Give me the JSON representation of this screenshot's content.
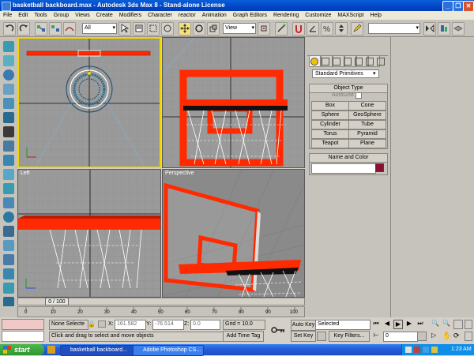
{
  "window": {
    "title": "basketball backboard.max - Autodesk 3ds Max 8  - Stand-alone License",
    "controls": [
      "minimize-icon",
      "restore-icon",
      "close-icon"
    ]
  },
  "menu": [
    "File",
    "Edit",
    "Tools",
    "Group",
    "Views",
    "Create",
    "Modifiers",
    "Character",
    "reactor",
    "Animation",
    "Graph Editors",
    "Rendering",
    "Customize",
    "MAXScript",
    "Help"
  ],
  "toolbar": {
    "selection_filter": "All",
    "ref_coord": "View",
    "named_sets": ""
  },
  "viewports": {
    "top_left": "",
    "top_right": "",
    "bottom_left": "Left",
    "bottom_right": "Perspective"
  },
  "command_panel": {
    "category": "Standard Primitives",
    "object_type_title": "Object Type",
    "autogrid": "AutoGrid",
    "buttons": [
      "Box",
      "Cone",
      "Sphere",
      "GeoSphere",
      "Cylinder",
      "Tube",
      "Torus",
      "Pyramid",
      "Teapot",
      "Plane"
    ],
    "name_color_title": "Name and Color",
    "object_name": "",
    "color_hex": "#8b1030"
  },
  "timeline": {
    "frame": "0 / 100",
    "ticks": [
      "0",
      "10",
      "20",
      "30",
      "40",
      "50",
      "60",
      "70",
      "80",
      "90",
      "100"
    ]
  },
  "status": {
    "selection": "None Selecte",
    "x_label": "X:",
    "x_value": "161.582",
    "y_label": "Y:",
    "y_value": "-76.514",
    "z_label": "Z:",
    "z_value": "0.0",
    "grid": "Grid = 10.0",
    "prompt": "Click and drag to select and move objects",
    "add_time_tag": "Add Time Tag",
    "auto_key": "Auto Key",
    "set_key": "Set Key",
    "key_mode": "Selected",
    "key_filters": "Key Filters...",
    "frame_field": "0"
  },
  "taskbar": {
    "start": "start",
    "tasks": [
      "basketball backboard...",
      "Adobe Photoshop CS..."
    ],
    "time": "1:23 AM"
  },
  "colors": {
    "title_blue": "#0046c8",
    "viewport_bg": "#9a9a9a",
    "perspective_bg": "#8a8a8a",
    "active_border": "#f2d600",
    "backboard_red": "#ff2a00"
  }
}
